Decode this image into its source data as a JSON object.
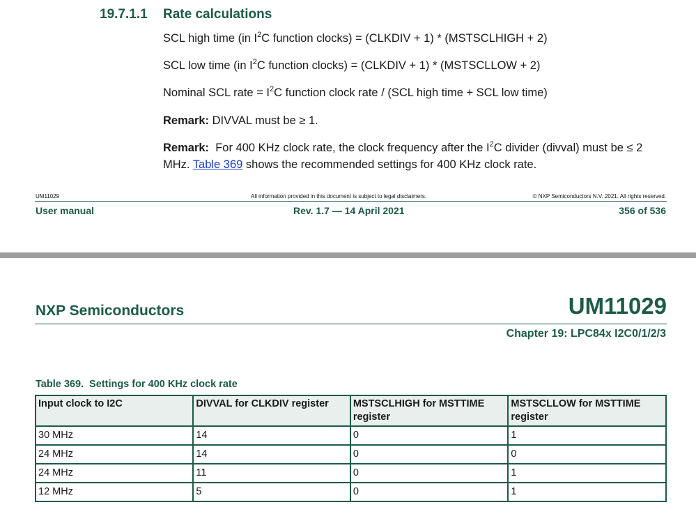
{
  "section": {
    "number": "19.7.1.1",
    "title": "Rate calculations"
  },
  "paragraphs": {
    "scl_high": {
      "pre": "SCL high time (in I",
      "sup": "2",
      "post": "C function clocks) = (CLKDIV + 1) * (MSTSCLHIGH + 2)"
    },
    "scl_low": {
      "pre": "SCL low time (in I",
      "sup": "2",
      "post": "C function clocks) = (CLKDIV + 1) * (MSTSCLLOW + 2)"
    },
    "nominal": {
      "pre": "Nominal SCL rate = I",
      "sup": "2",
      "post": "C function clock rate / (SCL high time + SCL low time)"
    },
    "remark1": {
      "label": "Remark:",
      "text": " DIVVAL must be ≥ 1."
    },
    "remark2": {
      "label": "Remark:",
      "text_a": "  For 400 KHz clock rate, the clock frequency after the I",
      "sup": "2",
      "text_b": "C divider (divval) must be ≤ 2 MHz. ",
      "link": "Table 369",
      "text_c": " shows the recommended settings for 400 KHz clock rate."
    }
  },
  "footer": {
    "doc_id": "UM11029",
    "legal": "All information provided in this document is subject to legal disclaimers.",
    "copyright": "© NXP Semiconductors N.V. 2021. All rights reserved.",
    "doc_type": "User manual",
    "revision": "Rev. 1.7 — 14 April 2021",
    "page": "356 of 536"
  },
  "header": {
    "company": "NXP Semiconductors",
    "doc_number": "UM11029",
    "chapter": "Chapter 19: LPC84x I2C0/1/2/3"
  },
  "table": {
    "caption_num": "Table 369.",
    "caption_text": "Settings for 400 KHz clock rate",
    "headers": [
      "Input clock to I2C",
      "DIVVAL for CLKDIV register",
      "MSTSCLHIGH for MSTTIME register",
      "MSTSCLLOW for MSTTIME register"
    ],
    "rows": [
      [
        "30 MHz",
        "14",
        "0",
        "1"
      ],
      [
        "24 MHz",
        "14",
        "0",
        "0"
      ],
      [
        "24 MHz",
        "11",
        "0",
        "1"
      ],
      [
        "12 MHz",
        "5",
        "0",
        "1"
      ]
    ]
  },
  "colors": {
    "brand_green": "#1b5b48",
    "link_blue": "#1a3ccc",
    "separator_gray": "#9e9e9e"
  }
}
